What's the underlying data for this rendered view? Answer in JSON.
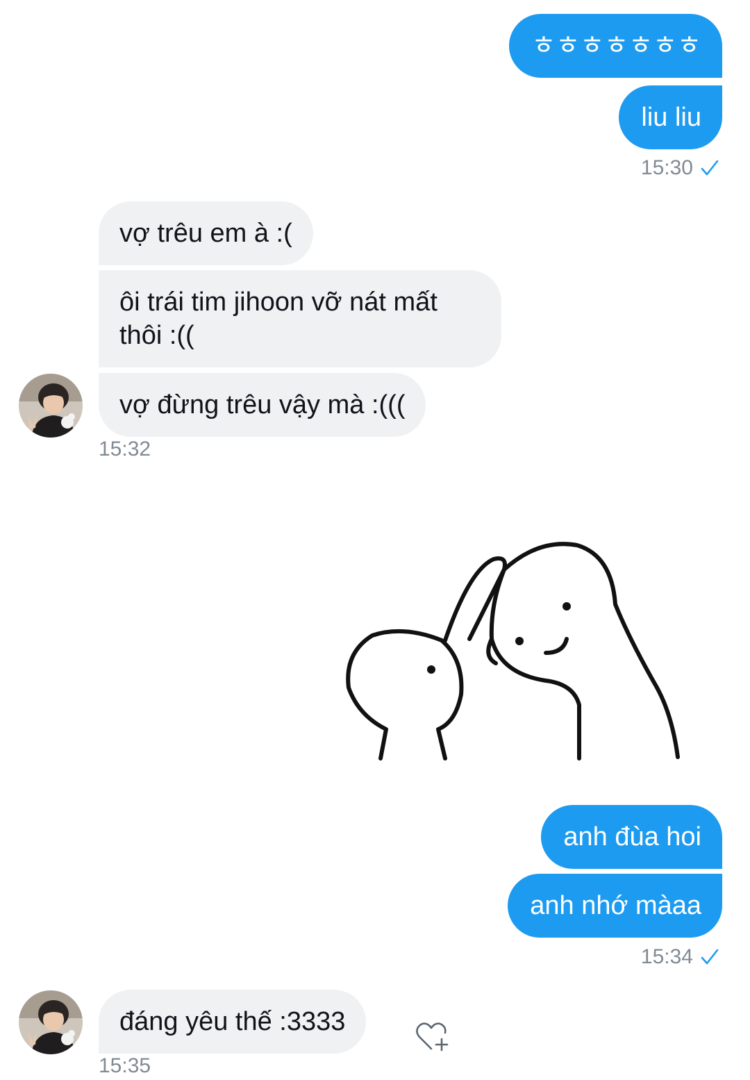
{
  "messages": {
    "m1": "ㅎㅎㅎㅎㅎㅎㅎ",
    "m2": "liu liu",
    "ts1": "15:30",
    "r1": "vợ trêu em à :(",
    "r2": "ôi trái tim jihoon vỡ nát mất thôi :((",
    "r3": "vợ đừng trêu vậy mà :(((",
    "ts2": "15:32",
    "m3": "anh đùa hoi",
    "m4": "anh nhớ màaa",
    "ts3": "15:34",
    "r4": "đáng yêu thế :3333",
    "ts4": "15:35"
  },
  "icons": {
    "read": "check-icon",
    "react": "heart-plus-icon",
    "sticker": "hug-sticker"
  },
  "colors": {
    "sent_bubble": "#1d9bf0",
    "received_bubble": "#eff1f3",
    "timestamp": "#808a94"
  }
}
